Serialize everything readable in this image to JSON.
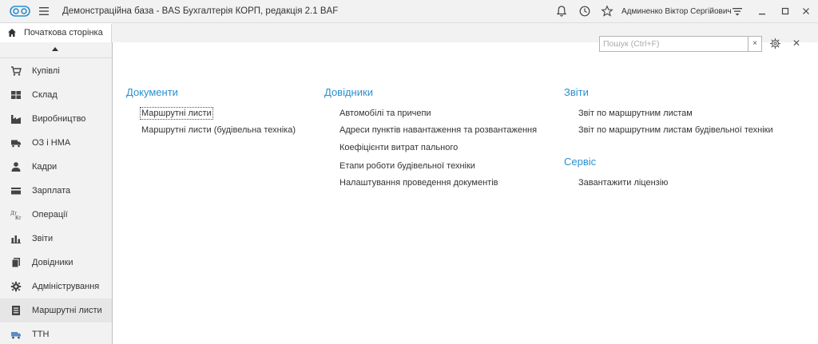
{
  "window": {
    "title": "Демонстраційна база - BAS Бухгалтерія КОРП, редакція 2.1 BAF",
    "user": "Админенко Віктор Сергійович"
  },
  "tabs": [
    {
      "label": "Початкова сторінка",
      "icon": "home-icon"
    }
  ],
  "sidebar": {
    "items": [
      {
        "label": "Купівлі",
        "icon": "cart-icon"
      },
      {
        "label": "Склад",
        "icon": "warehouse-icon"
      },
      {
        "label": "Виробництво",
        "icon": "factory-icon"
      },
      {
        "label": "ОЗ і НМА",
        "icon": "truck-icon"
      },
      {
        "label": "Кадри",
        "icon": "person-icon"
      },
      {
        "label": "Зарплата",
        "icon": "card-icon"
      },
      {
        "label": "Операції",
        "icon": "operations-icon"
      },
      {
        "label": "Звіти",
        "icon": "bar-chart-icon"
      },
      {
        "label": "Довідники",
        "icon": "books-icon"
      },
      {
        "label": "Адміністрування",
        "icon": "gear-icon"
      },
      {
        "label": "Маршрутні листи",
        "icon": "route-sheet-icon"
      },
      {
        "label": "ТТН",
        "icon": "truck-icon"
      }
    ],
    "active_index": 10
  },
  "search": {
    "placeholder": "Пошук (Ctrl+F)",
    "value": ""
  },
  "sections": {
    "documents": {
      "title": "Документи",
      "links": [
        "Маршрутні листи",
        "Маршрутні листи (будівельна техніка)"
      ]
    },
    "catalogs": {
      "title": "Довідники",
      "links": [
        "Автомобілі та причепи",
        "Адреси пунктів навантаження та розвантаження",
        "Коефіцієнти витрат пального",
        "Етапи роботи будівельної техніки",
        "Налаштування проведення документів"
      ]
    },
    "reports": {
      "title": "Звіти",
      "links": [
        "Звіт по маршрутним листам",
        "Звіт по маршрутним листам будівельної техніки"
      ]
    },
    "service": {
      "title": "Сервіс",
      "links": [
        "Завантажити ліцензію"
      ]
    }
  },
  "colors": {
    "accent": "#2a8fd0",
    "titlebar_bg": "#f2f2f2",
    "active_item_bg": "#e6e6e6"
  }
}
